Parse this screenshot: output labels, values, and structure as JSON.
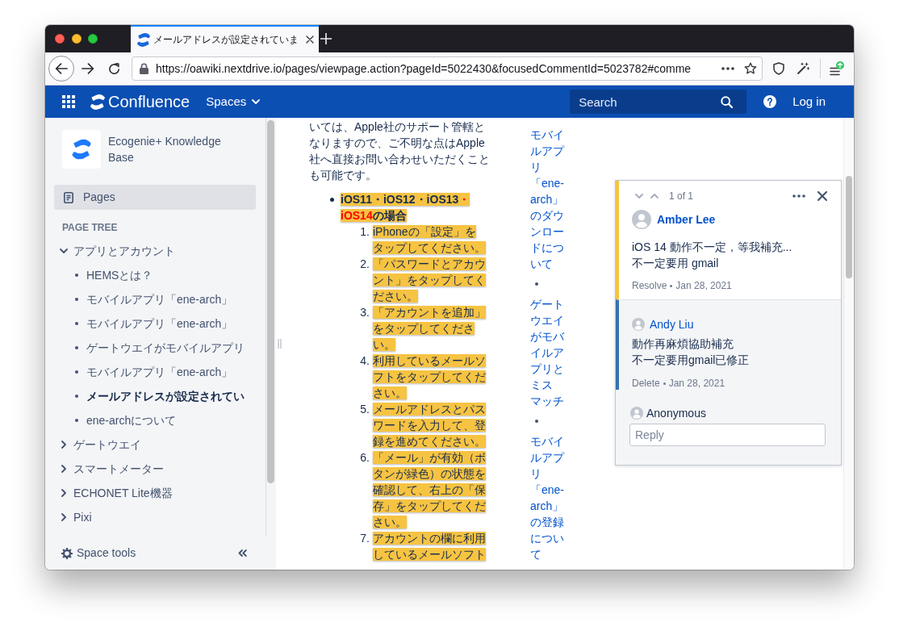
{
  "browser": {
    "tab_title": "メールアドレスが設定されていま",
    "url": "https://oawiki.nextdrive.io/pages/viewpage.action?pageId=5022430&focusedCommentId=5023782#comme"
  },
  "header": {
    "product": "Confluence",
    "spaces": "Spaces",
    "search": {
      "placeholder": "Search"
    },
    "login": "Log in"
  },
  "sidebar": {
    "space_name": "Ecogenie+ Knowledge Base",
    "nav": [
      {
        "label": "Pages",
        "selected": true
      }
    ],
    "tree_title": "PAGE TREE",
    "tree": [
      {
        "label": "アプリとアカウント",
        "expanded": true,
        "children": [
          {
            "label": "HEMSとは？",
            "selected": false
          },
          {
            "label": "モバイルアプリ「ene-arch」",
            "selected": false
          },
          {
            "label": "モバイルアプリ「ene-arch」",
            "selected": false
          },
          {
            "label": "ゲートウエイがモバイルアプリ",
            "selected": false
          },
          {
            "label": "モバイルアプリ「ene-arch」",
            "selected": false
          },
          {
            "label": "メールアドレスが設定されてい",
            "selected": true
          },
          {
            "label": "ene-archについて",
            "selected": false
          }
        ]
      },
      {
        "label": "ゲートウエイ",
        "expanded": false
      },
      {
        "label": "スマートメーター",
        "expanded": false
      },
      {
        "label": "ECHONET Lite機器",
        "expanded": false
      },
      {
        "label": "Pixi",
        "expanded": false
      }
    ],
    "footer": "Space tools"
  },
  "content": {
    "paragraph": "いては、Apple社のサポート管轄となりますので、ご不明な点はApple社へ直接お問い合わせいただくことも可能です。",
    "sections": [
      {
        "heading": [
          {
            "text": "iOS11・iOS12・iOS13",
            "kind": "plain"
          },
          {
            "text": "・iOS14",
            "kind": "alert"
          },
          {
            "text": "の場合",
            "kind": "plain"
          }
        ],
        "highlighted": true,
        "steps": [
          {
            "number": "1.",
            "text": "iPhoneの「設定」をタップしてください。",
            "highlighted": true
          },
          {
            "number": "2.",
            "text": "「パスワードとアカウント」をタップしてください。",
            "highlighted": true
          },
          {
            "number": "3.",
            "text": "「アカウントを追加」をタップしてください。",
            "highlighted": true
          },
          {
            "number": "4.",
            "text": "利用しているメールソフトをタップしてください。",
            "highlighted": true
          },
          {
            "number": "5.",
            "text": "メールアドレスとパスワードを入力して、登録を進めてください。",
            "highlighted": true
          },
          {
            "number": "6.",
            "text": "「メール」が有効（ボタンが緑色）の状態を確認して、右上の「保存」をタップしてください。",
            "highlighted": true
          },
          {
            "number": "7.",
            "text": "アカウントの欄に利用しているメールソフト",
            "highlighted": true
          }
        ]
      }
    ],
    "related_pages": [
      {
        "label": "モバイルアプリ「ene-arch」のダウンロードについて",
        "marker_visible": false
      },
      {
        "label": "ゲートウエイがモバイルアプリとミスマッチ",
        "marker_visible": true
      },
      {
        "label": "モバイルアプリ「ene-arch」の登録について",
        "marker_visible": true
      }
    ]
  },
  "comment_panel": {
    "counter": "1 of 1",
    "comments": [
      {
        "kind": "root",
        "author": "Amber Lee",
        "body": [
          "iOS 14 動作不一定，等我補充...",
          "不一定要用 gmail"
        ],
        "action": "Resolve",
        "date": "Jan 28, 2021"
      },
      {
        "kind": "reply",
        "author": "Andy Liu",
        "body": [
          "動作再麻煩協助補充",
          "不一定要用gmail已修正"
        ],
        "action": "Delete",
        "date": "Jan 28, 2021"
      }
    ],
    "reply": {
      "user": "Anonymous",
      "placeholder": "Reply"
    }
  }
}
